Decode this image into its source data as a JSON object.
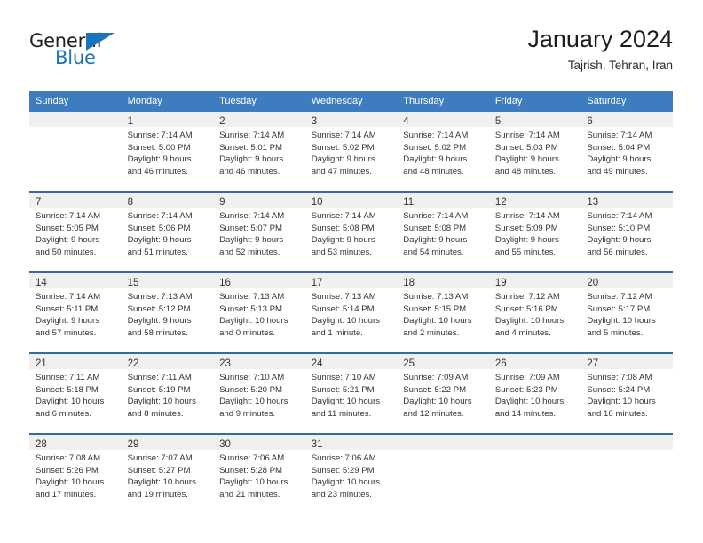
{
  "logo": {
    "word_top": "General",
    "word_bottom": "Blue",
    "flag_icon": "triangle-flag-icon",
    "color_blue": "#1a74bb",
    "color_dark": "#231f20"
  },
  "header": {
    "title": "January 2024",
    "subtitle": "Tajrish, Tehran, Iran"
  },
  "theme": {
    "header_blue": "#3d7cbf",
    "separator_blue": "#2e6da8",
    "daynum_band": "#f0f0f0",
    "text": "#333333"
  },
  "columns": [
    {
      "label": "Sunday"
    },
    {
      "label": "Monday"
    },
    {
      "label": "Tuesday"
    },
    {
      "label": "Wednesday"
    },
    {
      "label": "Thursday"
    },
    {
      "label": "Friday"
    },
    {
      "label": "Saturday"
    }
  ],
  "weeks": [
    {
      "days": [
        {
          "day": "",
          "sunrise": "",
          "sunset": "",
          "daylight1": "",
          "daylight2": ""
        },
        {
          "day": "1",
          "sunrise": "Sunrise: 7:14 AM",
          "sunset": "Sunset: 5:00 PM",
          "daylight1": "Daylight: 9 hours",
          "daylight2": "and 46 minutes."
        },
        {
          "day": "2",
          "sunrise": "Sunrise: 7:14 AM",
          "sunset": "Sunset: 5:01 PM",
          "daylight1": "Daylight: 9 hours",
          "daylight2": "and 46 minutes."
        },
        {
          "day": "3",
          "sunrise": "Sunrise: 7:14 AM",
          "sunset": "Sunset: 5:02 PM",
          "daylight1": "Daylight: 9 hours",
          "daylight2": "and 47 minutes."
        },
        {
          "day": "4",
          "sunrise": "Sunrise: 7:14 AM",
          "sunset": "Sunset: 5:02 PM",
          "daylight1": "Daylight: 9 hours",
          "daylight2": "and 48 minutes."
        },
        {
          "day": "5",
          "sunrise": "Sunrise: 7:14 AM",
          "sunset": "Sunset: 5:03 PM",
          "daylight1": "Daylight: 9 hours",
          "daylight2": "and 48 minutes."
        },
        {
          "day": "6",
          "sunrise": "Sunrise: 7:14 AM",
          "sunset": "Sunset: 5:04 PM",
          "daylight1": "Daylight: 9 hours",
          "daylight2": "and 49 minutes."
        }
      ]
    },
    {
      "days": [
        {
          "day": "7",
          "sunrise": "Sunrise: 7:14 AM",
          "sunset": "Sunset: 5:05 PM",
          "daylight1": "Daylight: 9 hours",
          "daylight2": "and 50 minutes."
        },
        {
          "day": "8",
          "sunrise": "Sunrise: 7:14 AM",
          "sunset": "Sunset: 5:06 PM",
          "daylight1": "Daylight: 9 hours",
          "daylight2": "and 51 minutes."
        },
        {
          "day": "9",
          "sunrise": "Sunrise: 7:14 AM",
          "sunset": "Sunset: 5:07 PM",
          "daylight1": "Daylight: 9 hours",
          "daylight2": "and 52 minutes."
        },
        {
          "day": "10",
          "sunrise": "Sunrise: 7:14 AM",
          "sunset": "Sunset: 5:08 PM",
          "daylight1": "Daylight: 9 hours",
          "daylight2": "and 53 minutes."
        },
        {
          "day": "11",
          "sunrise": "Sunrise: 7:14 AM",
          "sunset": "Sunset: 5:08 PM",
          "daylight1": "Daylight: 9 hours",
          "daylight2": "and 54 minutes."
        },
        {
          "day": "12",
          "sunrise": "Sunrise: 7:14 AM",
          "sunset": "Sunset: 5:09 PM",
          "daylight1": "Daylight: 9 hours",
          "daylight2": "and 55 minutes."
        },
        {
          "day": "13",
          "sunrise": "Sunrise: 7:14 AM",
          "sunset": "Sunset: 5:10 PM",
          "daylight1": "Daylight: 9 hours",
          "daylight2": "and 56 minutes."
        }
      ]
    },
    {
      "days": [
        {
          "day": "14",
          "sunrise": "Sunrise: 7:14 AM",
          "sunset": "Sunset: 5:11 PM",
          "daylight1": "Daylight: 9 hours",
          "daylight2": "and 57 minutes."
        },
        {
          "day": "15",
          "sunrise": "Sunrise: 7:13 AM",
          "sunset": "Sunset: 5:12 PM",
          "daylight1": "Daylight: 9 hours",
          "daylight2": "and 58 minutes."
        },
        {
          "day": "16",
          "sunrise": "Sunrise: 7:13 AM",
          "sunset": "Sunset: 5:13 PM",
          "daylight1": "Daylight: 10 hours",
          "daylight2": "and 0 minutes."
        },
        {
          "day": "17",
          "sunrise": "Sunrise: 7:13 AM",
          "sunset": "Sunset: 5:14 PM",
          "daylight1": "Daylight: 10 hours",
          "daylight2": "and 1 minute."
        },
        {
          "day": "18",
          "sunrise": "Sunrise: 7:13 AM",
          "sunset": "Sunset: 5:15 PM",
          "daylight1": "Daylight: 10 hours",
          "daylight2": "and 2 minutes."
        },
        {
          "day": "19",
          "sunrise": "Sunrise: 7:12 AM",
          "sunset": "Sunset: 5:16 PM",
          "daylight1": "Daylight: 10 hours",
          "daylight2": "and 4 minutes."
        },
        {
          "day": "20",
          "sunrise": "Sunrise: 7:12 AM",
          "sunset": "Sunset: 5:17 PM",
          "daylight1": "Daylight: 10 hours",
          "daylight2": "and 5 minutes."
        }
      ]
    },
    {
      "days": [
        {
          "day": "21",
          "sunrise": "Sunrise: 7:11 AM",
          "sunset": "Sunset: 5:18 PM",
          "daylight1": "Daylight: 10 hours",
          "daylight2": "and 6 minutes."
        },
        {
          "day": "22",
          "sunrise": "Sunrise: 7:11 AM",
          "sunset": "Sunset: 5:19 PM",
          "daylight1": "Daylight: 10 hours",
          "daylight2": "and 8 minutes."
        },
        {
          "day": "23",
          "sunrise": "Sunrise: 7:10 AM",
          "sunset": "Sunset: 5:20 PM",
          "daylight1": "Daylight: 10 hours",
          "daylight2": "and 9 minutes."
        },
        {
          "day": "24",
          "sunrise": "Sunrise: 7:10 AM",
          "sunset": "Sunset: 5:21 PM",
          "daylight1": "Daylight: 10 hours",
          "daylight2": "and 11 minutes."
        },
        {
          "day": "25",
          "sunrise": "Sunrise: 7:09 AM",
          "sunset": "Sunset: 5:22 PM",
          "daylight1": "Daylight: 10 hours",
          "daylight2": "and 12 minutes."
        },
        {
          "day": "26",
          "sunrise": "Sunrise: 7:09 AM",
          "sunset": "Sunset: 5:23 PM",
          "daylight1": "Daylight: 10 hours",
          "daylight2": "and 14 minutes."
        },
        {
          "day": "27",
          "sunrise": "Sunrise: 7:08 AM",
          "sunset": "Sunset: 5:24 PM",
          "daylight1": "Daylight: 10 hours",
          "daylight2": "and 16 minutes."
        }
      ]
    },
    {
      "days": [
        {
          "day": "28",
          "sunrise": "Sunrise: 7:08 AM",
          "sunset": "Sunset: 5:26 PM",
          "daylight1": "Daylight: 10 hours",
          "daylight2": "and 17 minutes."
        },
        {
          "day": "29",
          "sunrise": "Sunrise: 7:07 AM",
          "sunset": "Sunset: 5:27 PM",
          "daylight1": "Daylight: 10 hours",
          "daylight2": "and 19 minutes."
        },
        {
          "day": "30",
          "sunrise": "Sunrise: 7:06 AM",
          "sunset": "Sunset: 5:28 PM",
          "daylight1": "Daylight: 10 hours",
          "daylight2": "and 21 minutes."
        },
        {
          "day": "31",
          "sunrise": "Sunrise: 7:06 AM",
          "sunset": "Sunset: 5:29 PM",
          "daylight1": "Daylight: 10 hours",
          "daylight2": "and 23 minutes."
        },
        {
          "day": "",
          "sunrise": "",
          "sunset": "",
          "daylight1": "",
          "daylight2": ""
        },
        {
          "day": "",
          "sunrise": "",
          "sunset": "",
          "daylight1": "",
          "daylight2": ""
        },
        {
          "day": "",
          "sunrise": "",
          "sunset": "",
          "daylight1": "",
          "daylight2": ""
        }
      ]
    }
  ]
}
